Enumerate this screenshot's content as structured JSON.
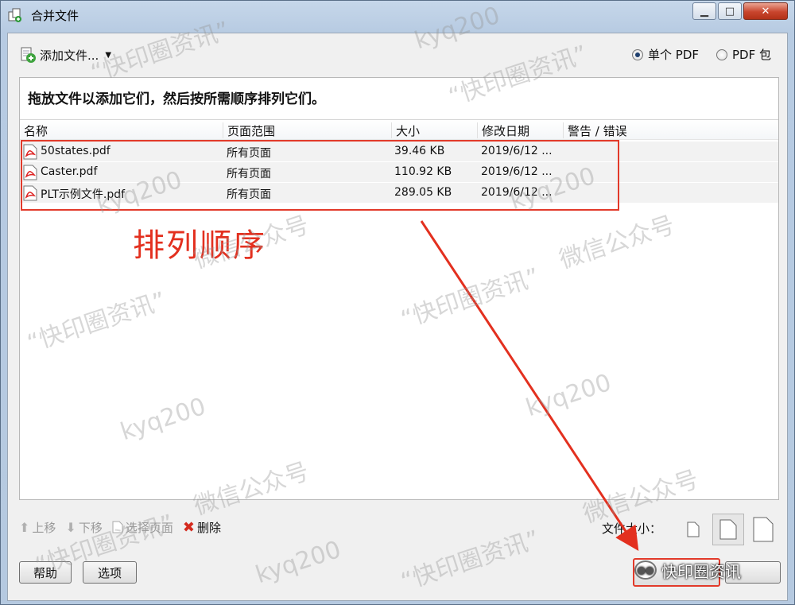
{
  "window": {
    "title": "合并文件"
  },
  "toolbar": {
    "add_files_label": "添加文件...",
    "output_options": [
      {
        "label": "单个 PDF",
        "selected": true
      },
      {
        "label": "PDF 包",
        "selected": false
      }
    ]
  },
  "instruction": "拖放文件以添加它们，然后按所需顺序排列它们。",
  "table": {
    "columns": [
      "名称",
      "页面范围",
      "大小",
      "修改日期",
      "警告 / 错误"
    ],
    "rows": [
      {
        "name": "50states.pdf",
        "range": "所有页面",
        "size": "39.46 KB",
        "date": "2019/6/12 ..."
      },
      {
        "name": "Caster.pdf",
        "range": "所有页面",
        "size": "110.92 KB",
        "date": "2019/6/12 ..."
      },
      {
        "name": "PLT示例文件.pdf",
        "range": "所有页面",
        "size": "289.05 KB",
        "date": "2019/6/12 ..."
      }
    ]
  },
  "annotation": {
    "text": "排列顺序",
    "color": "#e3301f"
  },
  "bottom_tools": {
    "move_up": "上移",
    "move_down": "下移",
    "choose_pages": "选择页面",
    "delete": "删除",
    "file_size_label": "文件大小："
  },
  "footer": {
    "help": "帮助",
    "options": "选项"
  },
  "wechat_badge": "快印圈资讯",
  "watermarks": [
    "kyq200",
    "微信公众号",
    "“快印圈资讯”"
  ],
  "colors": {
    "highlight": "#e23a2a",
    "title_bg": "#b7cbe2"
  }
}
